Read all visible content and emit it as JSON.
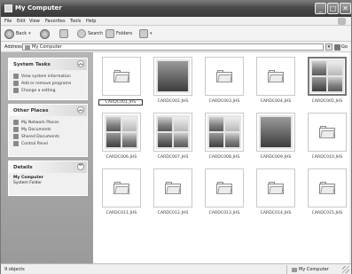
{
  "window": {
    "title": "My Computer",
    "controls": {
      "minimize": "_",
      "maximize": "□",
      "close": "✕"
    }
  },
  "menu": [
    "File",
    "Edit",
    "View",
    "Favorites",
    "Tools",
    "Help"
  ],
  "toolbar": {
    "back_label": "Back",
    "dropdown": "▾",
    "search_label": "Search",
    "folders_label": "Folders",
    "views_dropdown": "▾"
  },
  "address": {
    "label": "Address",
    "value": "My Computer",
    "drop": "▾",
    "go_label": "Go"
  },
  "panels": {
    "system": {
      "title": "System Tasks",
      "collapse": "︽",
      "items": [
        "View system information",
        "Add or remove programs",
        "Change a setting"
      ]
    },
    "other": {
      "title": "Other Places",
      "collapse": "︽",
      "items": [
        "My Network Places",
        "My Documents",
        "Shared Documents",
        "Control Panel"
      ]
    },
    "details": {
      "title": "Details",
      "collapse": "︾",
      "name": "My Computer",
      "type": "System Folder"
    }
  },
  "files": [
    {
      "label": "CARDC001.JHS",
      "kind": "folder"
    },
    {
      "label": "CARDC002.JHS",
      "kind": "photos-single"
    },
    {
      "label": "CARDC003.JHS",
      "kind": "folder"
    },
    {
      "label": "CARDC004.JHS",
      "kind": "folder"
    },
    {
      "label": "CARDC005.JHS",
      "kind": "photos4"
    },
    {
      "label": "CARDC006.JHS",
      "kind": "photos4"
    },
    {
      "label": "CARDC007.JHS",
      "kind": "photos4"
    },
    {
      "label": "CARDC008.JHS",
      "kind": "photos4"
    },
    {
      "label": "CARDC009.JHS",
      "kind": "photos-single"
    },
    {
      "label": "CARDC010.JHS",
      "kind": "folder"
    },
    {
      "label": "CARDC011.JHS",
      "kind": "folder"
    },
    {
      "label": "CARDC012.JHS",
      "kind": "folder"
    },
    {
      "label": "CARDC013.JHS",
      "kind": "folder"
    },
    {
      "label": "CARDC014.JHS",
      "kind": "folder"
    },
    {
      "label": "CARDC015.JHS",
      "kind": "folder"
    }
  ],
  "status": {
    "left": "9 objects",
    "right": "My Computer"
  }
}
